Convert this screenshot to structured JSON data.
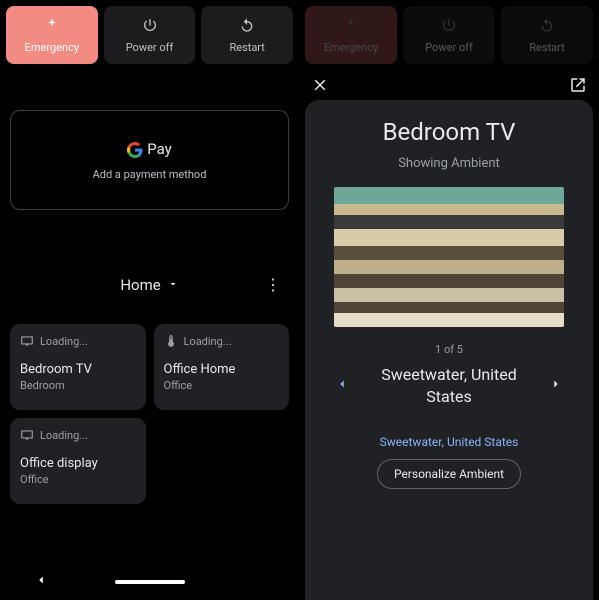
{
  "power": {
    "emergency": "Emergency",
    "power_off": "Power off",
    "restart": "Restart"
  },
  "pay": {
    "brand": "Pay",
    "subtitle": "Add a payment method"
  },
  "home": {
    "label": "Home"
  },
  "tiles": [
    {
      "loading": "Loading...",
      "title": "Bedroom TV",
      "sub": "Bedroom",
      "icon": "tv"
    },
    {
      "loading": "Loading...",
      "title": "Office Home",
      "sub": "Office",
      "icon": "thermostat"
    },
    {
      "loading": "Loading...",
      "title": "Office display",
      "sub": "Office",
      "icon": "display"
    }
  ],
  "detail": {
    "title": "Bedroom TV",
    "status": "Showing Ambient",
    "counter": "1 of 5",
    "location": "Sweetwater, United States",
    "link": "Sweetwater, United States",
    "personalize": "Personalize Ambient"
  }
}
